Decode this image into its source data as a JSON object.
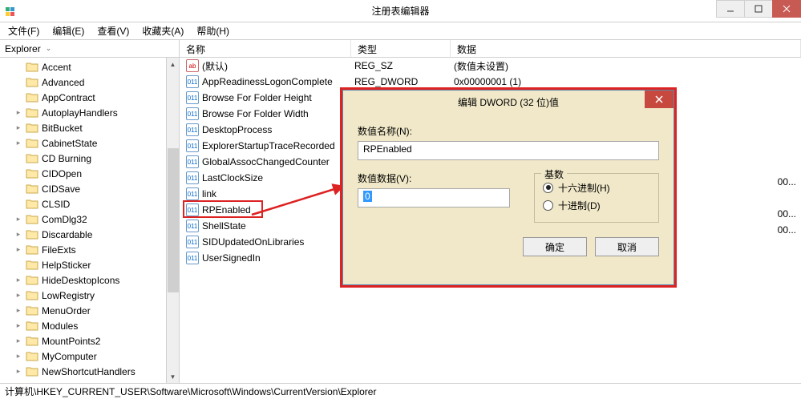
{
  "window": {
    "title": "注册表编辑器"
  },
  "menu": {
    "file": "文件(F)",
    "edit": "编辑(E)",
    "view": "查看(V)",
    "fav": "收藏夹(A)",
    "help": "帮助(H)"
  },
  "tree": {
    "root": "Explorer",
    "items": [
      "Accent",
      "Advanced",
      "AppContract",
      "AutoplayHandlers",
      "BitBucket",
      "CabinetState",
      "CD Burning",
      "CIDOpen",
      "CIDSave",
      "CLSID",
      "ComDlg32",
      "Discardable",
      "FileExts",
      "HelpSticker",
      "HideDesktopIcons",
      "LowRegistry",
      "MenuOrder",
      "Modules",
      "MountPoints2",
      "MyComputer",
      "NewShortcutHandlers"
    ]
  },
  "cols": {
    "name": "名称",
    "type": "类型",
    "data": "数据"
  },
  "rows": [
    {
      "icon": "sz",
      "name": "(默认)",
      "type": "REG_SZ",
      "data": "(数值未设置)"
    },
    {
      "icon": "dw",
      "name": "AppReadinessLogonComplete",
      "type": "REG_DWORD",
      "data": "0x00000001 (1)"
    },
    {
      "icon": "dw",
      "name": "Browse For Folder Height",
      "type": "",
      "data": ""
    },
    {
      "icon": "dw",
      "name": "Browse For Folder Width",
      "type": "",
      "data": ""
    },
    {
      "icon": "dw",
      "name": "DesktopProcess",
      "type": "",
      "data": ""
    },
    {
      "icon": "dw",
      "name": "ExplorerStartupTraceRecorded",
      "type": "",
      "data": ""
    },
    {
      "icon": "dw",
      "name": "GlobalAssocChangedCounter",
      "type": "",
      "data": ""
    },
    {
      "icon": "dw",
      "name": "LastClockSize",
      "type": "",
      "data": ""
    },
    {
      "icon": "dw",
      "name": "link",
      "type": "",
      "data": ""
    },
    {
      "icon": "dw",
      "name": "RPEnabled",
      "type": "",
      "data": ""
    },
    {
      "icon": "dw",
      "name": "ShellState",
      "type": "",
      "data": ""
    },
    {
      "icon": "dw",
      "name": "SIDUpdatedOnLibraries",
      "type": "",
      "data": ""
    },
    {
      "icon": "dw",
      "name": "UserSignedIn",
      "type": "",
      "data": ""
    }
  ],
  "truncated_tail": "00...",
  "statusbar": "计算机\\HKEY_CURRENT_USER\\Software\\Microsoft\\Windows\\CurrentVersion\\Explorer",
  "dialog": {
    "title": "编辑 DWORD (32 位)值",
    "name_label": "数值名称(N):",
    "name_value": "RPEnabled",
    "data_label": "数值数据(V):",
    "data_value": "0",
    "base_label": "基数",
    "radio_hex": "十六进制(H)",
    "radio_dec": "十进制(D)",
    "ok": "确定",
    "cancel": "取消"
  }
}
